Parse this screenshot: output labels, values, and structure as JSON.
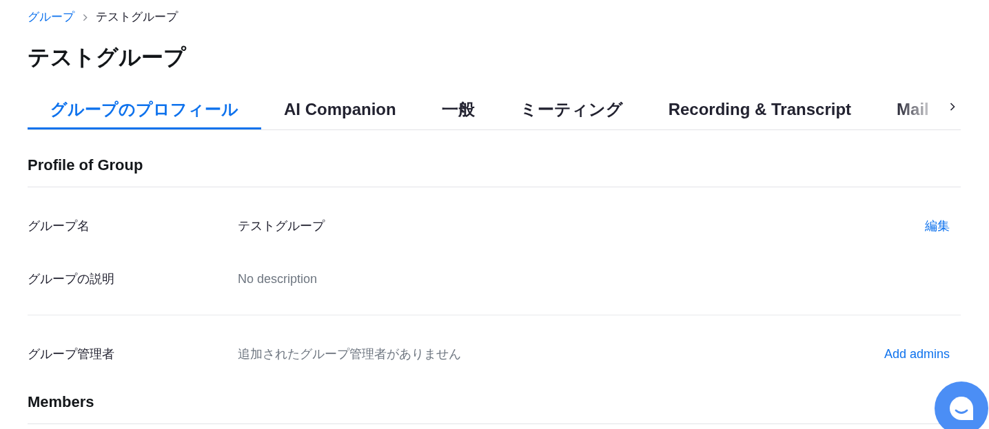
{
  "breadcrumb": [
    {
      "label": "グループ",
      "kind": "link"
    },
    {
      "label": "テストグループ",
      "kind": "current"
    }
  ],
  "title": "テストグループ",
  "tabs": [
    {
      "label": "グループのプロフィール",
      "selected": true
    },
    {
      "label": "AI Companion",
      "selected": false
    },
    {
      "label": "一般",
      "selected": false
    },
    {
      "label": "ミーティング",
      "selected": false
    },
    {
      "label": "Recording & Transcript",
      "selected": false
    },
    {
      "label": "Mail",
      "selected": false
    }
  ],
  "sections": [
    {
      "heading": "Profile of Group",
      "row_groups": [
        [
          {
            "label": "グループ名",
            "value": "テストグループ",
            "empty": false,
            "action": "編集"
          },
          {
            "label": "グループの説明",
            "value": "No description",
            "empty": true
          }
        ],
        [
          {
            "label": "グループ管理者",
            "value": "追加されたグループ管理者がありません",
            "empty": true,
            "action": "Add admins"
          }
        ]
      ]
    },
    {
      "heading": "Members"
    }
  ]
}
